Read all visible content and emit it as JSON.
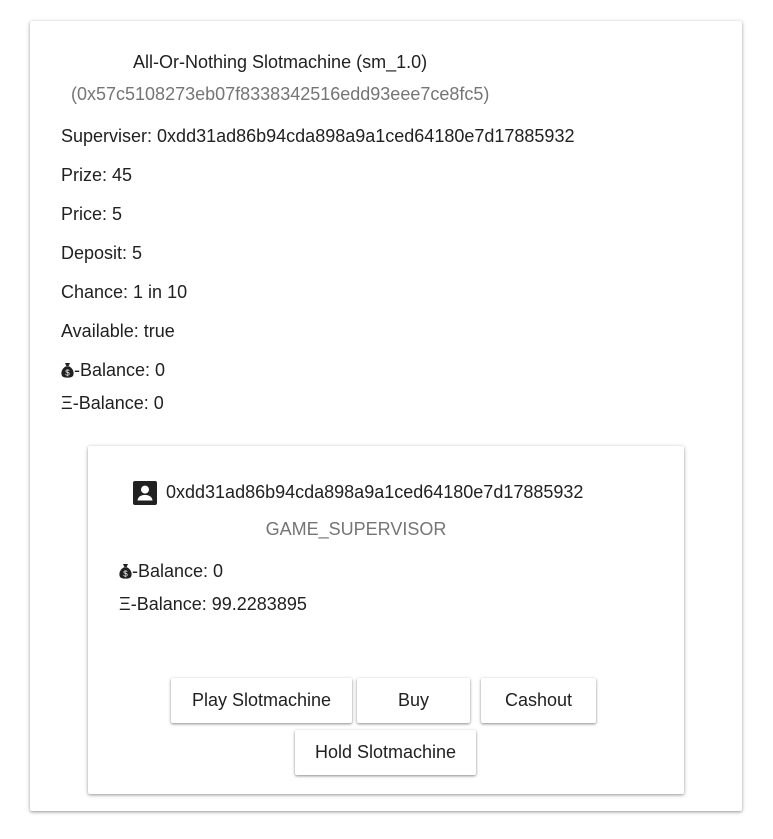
{
  "contract": {
    "title": "All-Or-Nothing Slotmachine (sm_1.0)",
    "address": "(0x57c5108273eb07f8338342516edd93eee7ce8fc5)",
    "superviser_label": "Superviser:",
    "superviser_value": "0xdd31ad86b94cda898a9a1ced64180e7d17885932",
    "prize_label": "Prize:",
    "prize_value": "45",
    "price_label": "Price:",
    "price_value": "5",
    "deposit_label": "Deposit:",
    "deposit_value": "5",
    "chance_label": "Chance:",
    "chance_value": "1 in 10",
    "available_label": "Available:",
    "available_value": "true",
    "token_balance_label": "-Balance:",
    "token_balance_value": "0",
    "eth_balance_label": "Ξ-Balance:",
    "eth_balance_value": "0"
  },
  "account": {
    "icon": "account-box-icon",
    "address": "0xdd31ad86b94cda898a9a1ced64180e7d17885932",
    "role": "GAME_SUPERVISOR",
    "token_balance_label": "-Balance:",
    "token_balance_value": "0",
    "eth_balance_label": "Ξ-Balance:",
    "eth_balance_value": "99.2283895"
  },
  "actions": {
    "play_label": "Play Slotmachine",
    "buy_label": "Buy",
    "cashout_label": "Cashout",
    "hold_label": "Hold Slotmachine"
  },
  "icons": {
    "token": "money-bag-icon"
  }
}
